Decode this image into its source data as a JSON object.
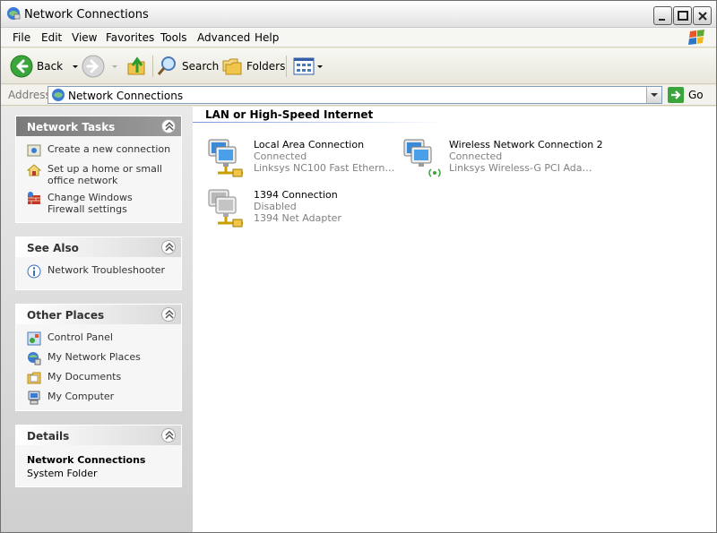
{
  "window": {
    "title": "Network Connections",
    "controls": {
      "minimize": "minimize-icon",
      "maximize": "maximize-icon",
      "close": "close-icon"
    }
  },
  "menu": {
    "items": [
      {
        "label": "File"
      },
      {
        "label": "Edit"
      },
      {
        "label": "View"
      },
      {
        "label": "Favorites"
      },
      {
        "label": "Tools"
      },
      {
        "label": "Advanced"
      },
      {
        "label": "Help"
      }
    ]
  },
  "toolbar": {
    "back": "Back",
    "search": "Search",
    "folders": "Folders"
  },
  "address": {
    "label": "Address",
    "value": "Network Connections",
    "go": "Go"
  },
  "taskpane": {
    "network_tasks": {
      "title": "Network Tasks",
      "items": [
        {
          "label": "Create a new connection",
          "icon": "new-connection-icon"
        },
        {
          "label": "Set up a home or small office network",
          "icon": "home-network-icon"
        },
        {
          "label": "Change Windows Firewall settings",
          "icon": "firewall-icon"
        }
      ]
    },
    "see_also": {
      "title": "See Also",
      "items": [
        {
          "label": "Network Troubleshooter",
          "icon": "info-icon"
        }
      ]
    },
    "other_places": {
      "title": "Other Places",
      "items": [
        {
          "label": "Control Panel",
          "icon": "control-panel-icon"
        },
        {
          "label": "My Network Places",
          "icon": "network-places-icon"
        },
        {
          "label": "My Documents",
          "icon": "documents-icon"
        },
        {
          "label": "My Computer",
          "icon": "computer-icon"
        }
      ]
    },
    "details": {
      "title": "Details",
      "name": "Network Connections",
      "type": "System Folder"
    }
  },
  "content": {
    "group_title": "LAN or High-Speed Internet",
    "connections": [
      {
        "name": "Local Area Connection",
        "status": "Connected",
        "device": "Linksys NC100 Fast Ethernet ...",
        "icon": "lan-connection-icon"
      },
      {
        "name": "Wireless Network Connection 2",
        "status": "Connected",
        "device": "Linksys Wireless-G PCI Adapte...",
        "icon": "wireless-connection-icon"
      },
      {
        "name": "1394 Connection",
        "status": "Disabled",
        "device": "1394 Net Adapter",
        "icon": "1394-connection-icon"
      }
    ]
  },
  "colors": {
    "group_line": "#7a96df",
    "muted_text": "#808080",
    "panel_header_primary": "#7a7a7a"
  }
}
